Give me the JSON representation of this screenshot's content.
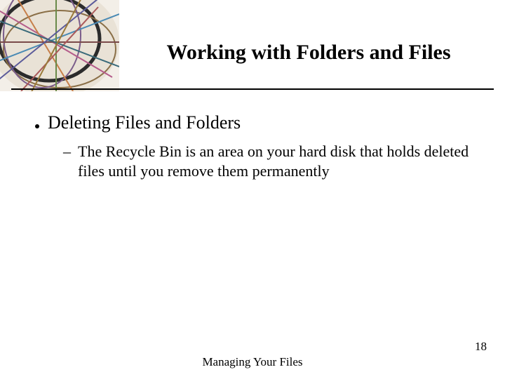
{
  "header": {
    "title": "Working with Folders and Files"
  },
  "body": {
    "bullet": "Deleting Files and Folders",
    "sub_bullet": "The Recycle Bin is an area on your hard disk that holds deleted files until you remove them permanently",
    "dash": "–"
  },
  "footer": {
    "center": "Managing Your Files",
    "page": "18"
  }
}
